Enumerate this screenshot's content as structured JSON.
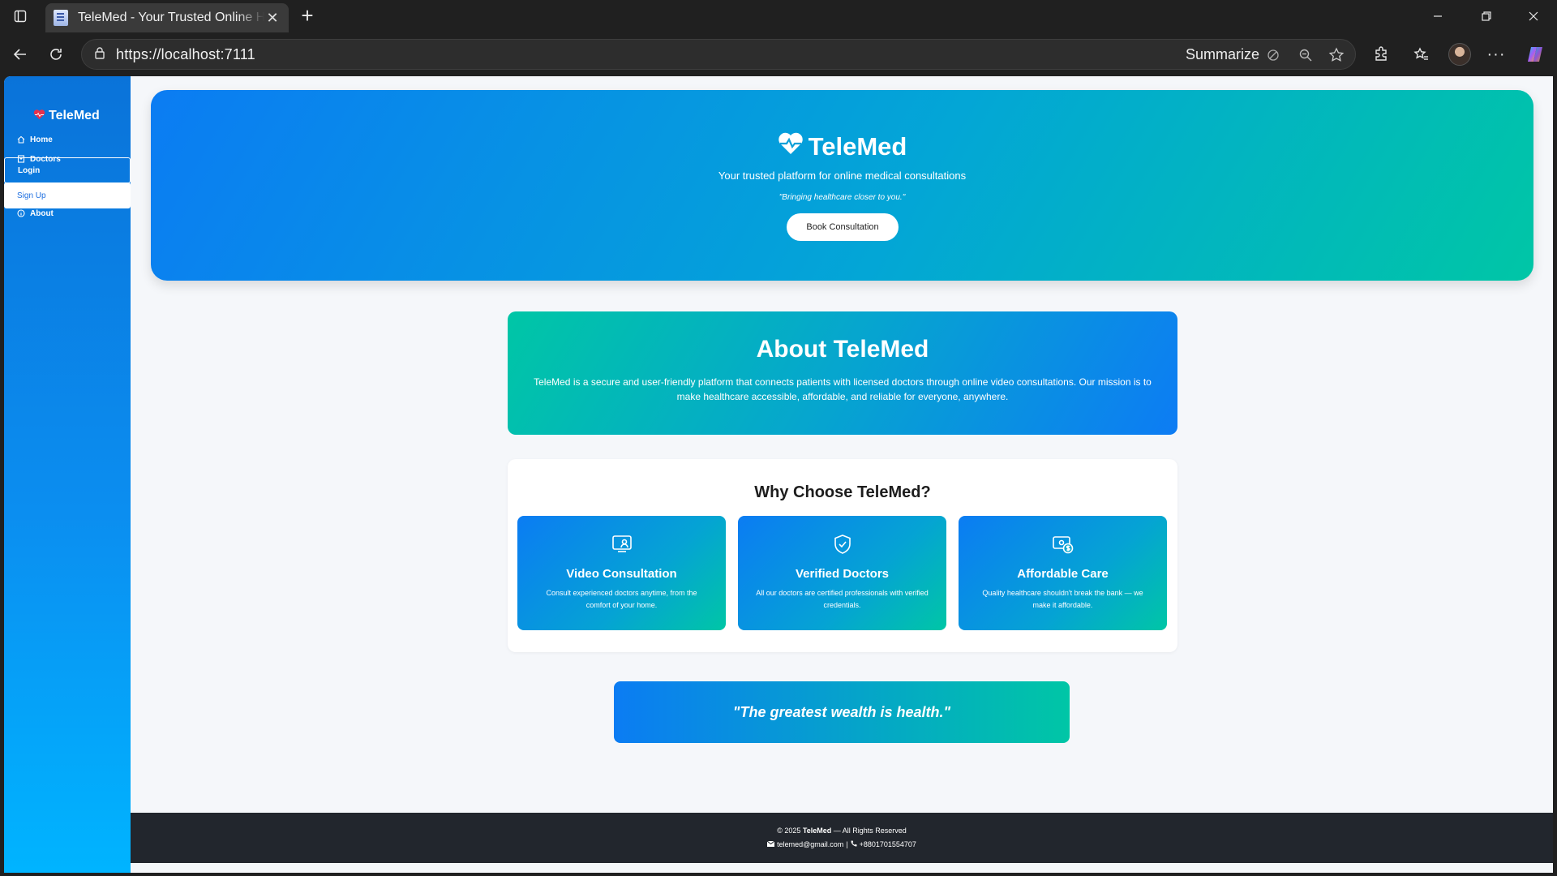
{
  "browser": {
    "tab_title": "TeleMed - Your Trusted Online Health Platform",
    "url": "https://localhost:7111",
    "summarize_label": "Summarize"
  },
  "sidebar": {
    "brand": "TeleMed",
    "items": [
      {
        "label": "Home",
        "icon": "home-icon"
      },
      {
        "label": "Doctors",
        "icon": "hospital-icon"
      },
      {
        "label": "Login"
      },
      {
        "label": "Sign Up"
      },
      {
        "label": "About",
        "icon": "info-icon"
      }
    ]
  },
  "hero": {
    "title": "TeleMed",
    "subtitle": "Your trusted platform for online medical consultations",
    "tagline": "\"Bringing healthcare closer to you.\"",
    "button": "Book Consultation"
  },
  "about": {
    "title": "About TeleMed",
    "text": "TeleMed is a secure and user-friendly platform that connects patients with licensed doctors through online video consultations. Our mission is to make healthcare accessible, affordable, and reliable for everyone, anywhere."
  },
  "why": {
    "title": "Why Choose TeleMed?",
    "cards": [
      {
        "title": "Video Consultation",
        "text": "Consult experienced doctors anytime, from the comfort of your home.",
        "icon": "video-person-icon"
      },
      {
        "title": "Verified Doctors",
        "text": "All our doctors are certified professionals with verified credentials.",
        "icon": "shield-check-icon"
      },
      {
        "title": "Affordable Care",
        "text": "Quality healthcare shouldn't break the bank — we make it affordable.",
        "icon": "money-icon"
      }
    ]
  },
  "quote": "\"The greatest wealth is health.\"",
  "footer": {
    "copyright_prefix": "© 2025",
    "brand": "TeleMed",
    "copyright_suffix": "— All Rights Reserved",
    "email": "telemed@gmail.com",
    "separator": "|",
    "phone": "+8801701554707"
  },
  "colors": {
    "sidebar_top": "#0a73d9",
    "sidebar_bottom": "#00b4ff",
    "gradient_blue": "#0b7cf3",
    "gradient_teal": "#00c6a6",
    "footer_bg": "#22262d",
    "brand_heart": "#e8314b"
  }
}
